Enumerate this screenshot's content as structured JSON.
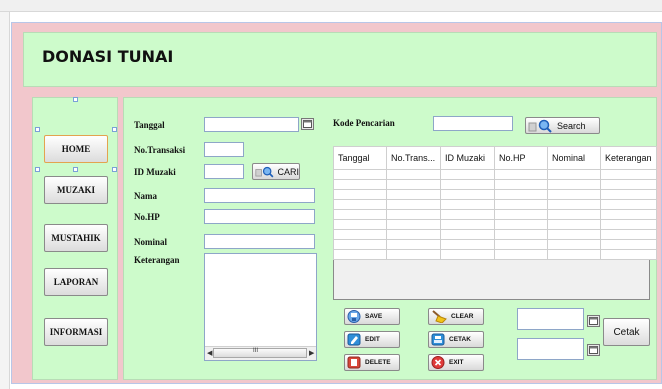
{
  "title": "DONASI TUNAI",
  "nav": [
    {
      "label": "HOME",
      "selected": true
    },
    {
      "label": "MUZAKI",
      "selected": false
    },
    {
      "label": "MUSTAHIK",
      "selected": false
    },
    {
      "label": "LAPORAN",
      "selected": false
    },
    {
      "label": "INFORMASI",
      "selected": false
    }
  ],
  "form": {
    "tanggal": "Tanggal",
    "no_transaksi": "No.Transaksi",
    "id_muzaki": "ID Muzaki",
    "nama": "Nama",
    "no_hp": "No.HP",
    "nominal": "Nominal",
    "keterangan": "Keterangan",
    "cari_button": "CARI",
    "scrollbar_grip": "III"
  },
  "search": {
    "label": "Kode Pencarian",
    "button": "Search"
  },
  "table": {
    "columns": [
      "Tanggal",
      "No.Trans...",
      "ID Muzaki",
      "No.HP",
      "Nominal",
      "Keterangan"
    ]
  },
  "actions": {
    "save": "SAVE",
    "clear": "CLEAR",
    "edit": "EDIT",
    "cetak_small": "CETAK",
    "delete": "DELETE",
    "exit": "EXIT",
    "cetak": "Cetak"
  },
  "colors": {
    "panel_green": "#cdfbcb",
    "frame_pink": "#f2c7cc",
    "selection_orange": "#e3a34f"
  }
}
